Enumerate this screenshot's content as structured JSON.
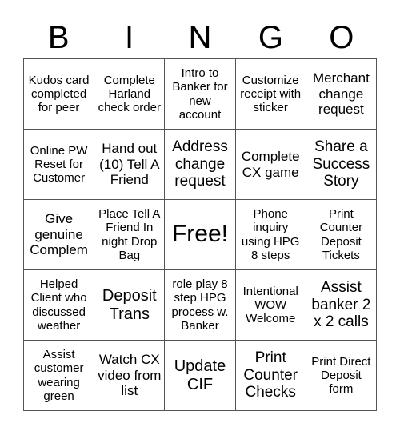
{
  "header": [
    "B",
    "I",
    "N",
    "G",
    "O"
  ],
  "cells": [
    [
      "Kudos card completed for peer",
      "Complete Harland check order",
      "Intro to Banker for new account",
      "Customize receipt with sticker",
      "Merchant change request"
    ],
    [
      "Online PW Reset for Customer",
      "Hand out (10) Tell A Friend",
      "Address change request",
      "Complete CX game",
      "Share a Success Story"
    ],
    [
      "Give genuine Complem",
      "Place Tell A Friend In night Drop Bag",
      "Free!",
      "Phone inquiry using HPG 8 steps",
      "Print Counter Deposit Tickets"
    ],
    [
      "Helped Client who discussed weather",
      "Deposit Trans",
      "role play 8 step HPG process w. Banker",
      "Intentional WOW Welcome",
      "Assist banker 2 x 2 calls"
    ],
    [
      "Assist customer wearing green",
      "Watch CX video from list",
      "Update CIF",
      "Print Counter Checks",
      "Print Direct Deposit form"
    ]
  ]
}
